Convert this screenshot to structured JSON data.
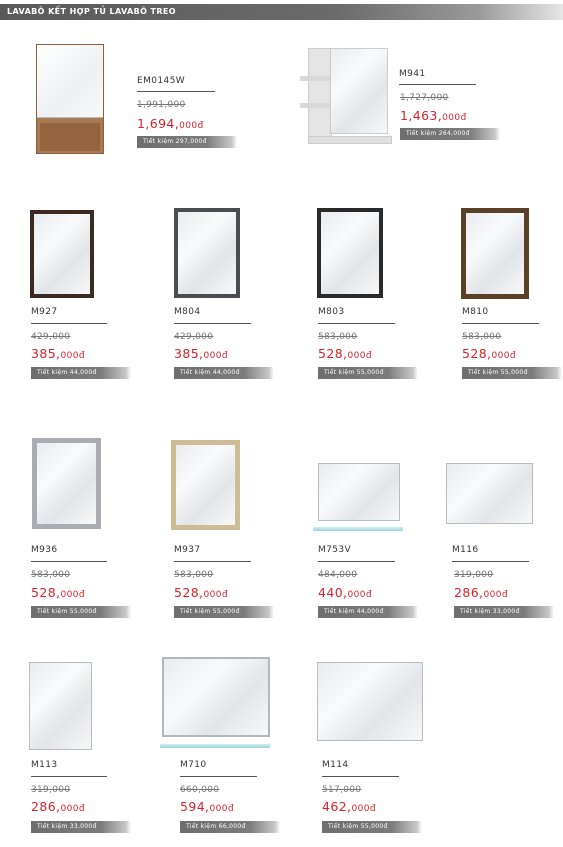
{
  "header": {
    "title": "LAVABÔ KẾT HỢP TỦ LAVABÔ TREO"
  },
  "save_prefix": "Tiết kiệm",
  "products": [
    {
      "code": "EM0145W",
      "old_price": "1,991,000",
      "new_price": "1,694,",
      "currency": "000đ",
      "saving": "297,000đ"
    },
    {
      "code": "M941",
      "old_price": "1,727,000",
      "new_price": "1,463,",
      "currency": "000đ",
      "saving": "264,000đ"
    },
    {
      "code": "M927",
      "old_price": "429,000",
      "new_price": "385,",
      "currency": "000đ",
      "saving": "44,000đ"
    },
    {
      "code": "M804",
      "old_price": "429,000",
      "new_price": "385,",
      "currency": "000đ",
      "saving": "44,000đ"
    },
    {
      "code": "M803",
      "old_price": "583,000",
      "new_price": "528,",
      "currency": "000đ",
      "saving": "55,000đ"
    },
    {
      "code": "M810",
      "old_price": "583,000",
      "new_price": "528,",
      "currency": "000đ",
      "saving": "55,000đ"
    },
    {
      "code": "M936",
      "old_price": "583,000",
      "new_price": "528,",
      "currency": "000đ",
      "saving": "55,000đ"
    },
    {
      "code": "M937",
      "old_price": "583,000",
      "new_price": "528,",
      "currency": "000đ",
      "saving": "55,000đ"
    },
    {
      "code": "M753V",
      "old_price": "484,000",
      "new_price": "440,",
      "currency": "000đ",
      "saving": "44,000đ"
    },
    {
      "code": "M116",
      "old_price": "319,000",
      "new_price": "286,",
      "currency": "000đ",
      "saving": "33,000đ"
    },
    {
      "code": "M113",
      "old_price": "319,000",
      "new_price": "286,",
      "currency": "000đ",
      "saving": "33,000đ"
    },
    {
      "code": "M710",
      "old_price": "660,000",
      "new_price": "594,",
      "currency": "000đ",
      "saving": "66,000đ"
    },
    {
      "code": "M114",
      "old_price": "517,000",
      "new_price": "462,",
      "currency": "000đ",
      "saving": "55,000đ"
    }
  ]
}
